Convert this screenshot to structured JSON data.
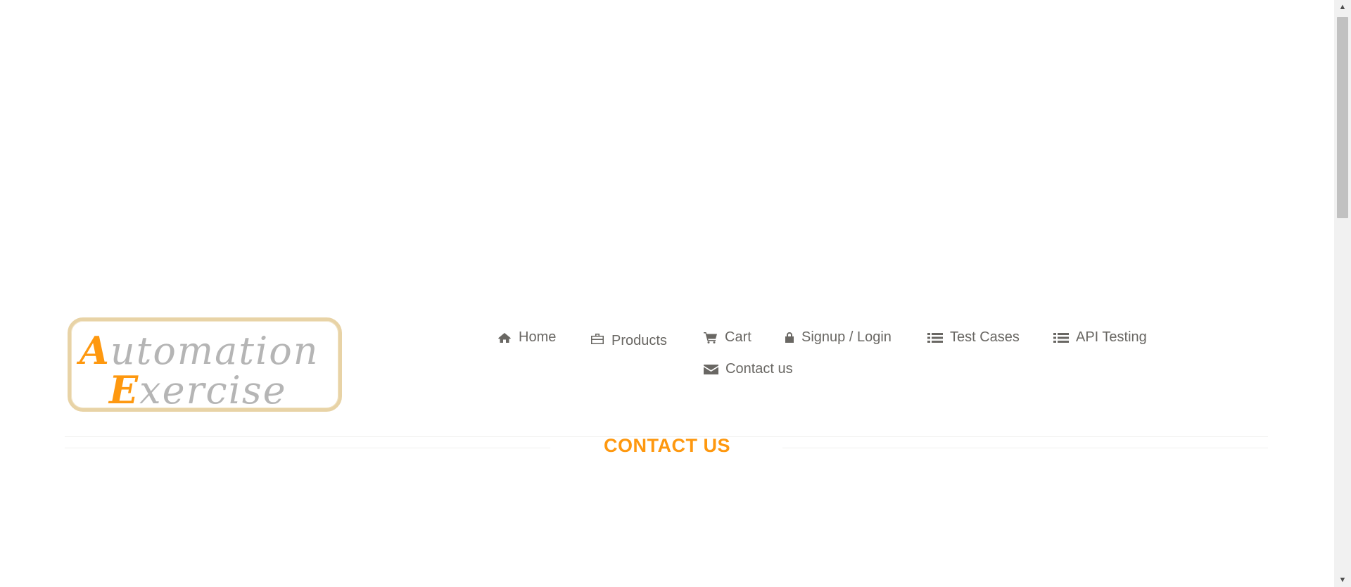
{
  "logo": {
    "line1_cap": "A",
    "line1_rest": "utomation",
    "line2_cap": "E",
    "line2_rest": "xercise"
  },
  "nav": {
    "items": [
      {
        "label": "Home",
        "icon": "home-icon"
      },
      {
        "label": "Products",
        "icon": "briefcase-icon"
      },
      {
        "label": "Cart",
        "icon": "cart-icon"
      },
      {
        "label": "Signup / Login",
        "icon": "lock-icon"
      },
      {
        "label": "Test Cases",
        "icon": "list-icon"
      },
      {
        "label": "API Testing",
        "icon": "list-icon"
      },
      {
        "label": "Contact us",
        "icon": "envelope-icon"
      }
    ]
  },
  "page": {
    "title": "CONTACT US"
  },
  "colors": {
    "accent": "#fe980f",
    "nav_text": "#696763",
    "logo_border": "#e8d3a6"
  }
}
